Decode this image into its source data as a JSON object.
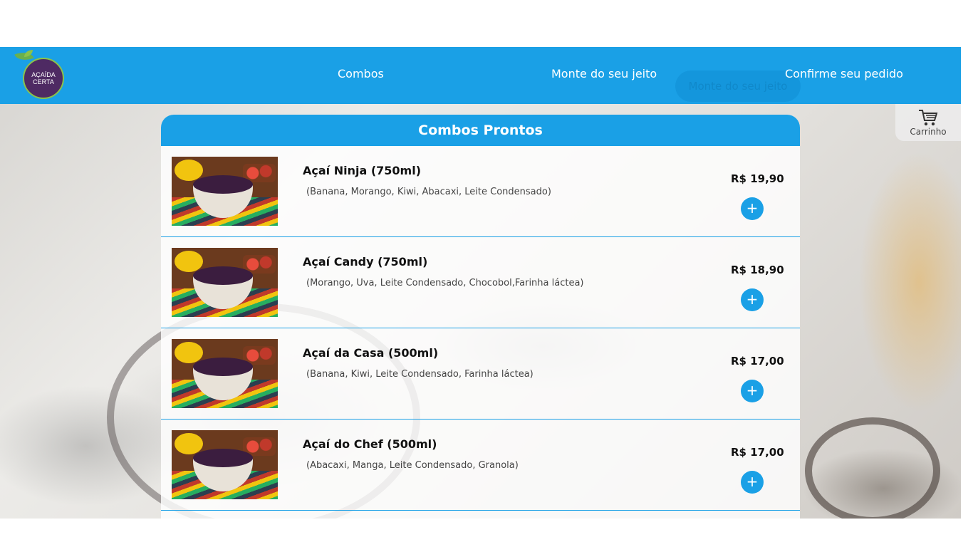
{
  "header": {
    "logo_text_top": "AÇAÍDA",
    "logo_text_bottom": "CERTA",
    "nav": [
      {
        "label": "Combos"
      },
      {
        "label": "Monte do seu jeito"
      },
      {
        "label": "Confirme seu pedido"
      }
    ],
    "ghost_button_label": "Monte do seu jeito"
  },
  "cart": {
    "label": "Carrinho",
    "icon": "cart-icon"
  },
  "panel": {
    "title": "Combos Prontos",
    "items": [
      {
        "name": "Açaí Ninja (750ml)",
        "desc": "(Banana, Morango, Kiwi, Abacaxi, Leite Condensado)",
        "price": "R$ 19,90",
        "add": "+"
      },
      {
        "name": "Açaí Candy (750ml)",
        "desc": "(Morango, Uva, Leite Condensado, Chocobol,Farinha láctea)",
        "price": "R$ 18,90",
        "add": "+"
      },
      {
        "name": "Açaí da Casa (500ml)",
        "desc": "(Banana, Kiwi, Leite Condensado, Farinha láctea)",
        "price": "R$ 17,00",
        "add": "+"
      },
      {
        "name": "Açaí do Chef (500ml)",
        "desc": "(Abacaxi, Manga, Leite Condensado, Granola)",
        "price": "R$ 17,00",
        "add": "+"
      }
    ]
  },
  "colors": {
    "accent": "#1aa0e6",
    "brand_purple": "#4e2a63",
    "leaf_green": "#6ab04c"
  }
}
